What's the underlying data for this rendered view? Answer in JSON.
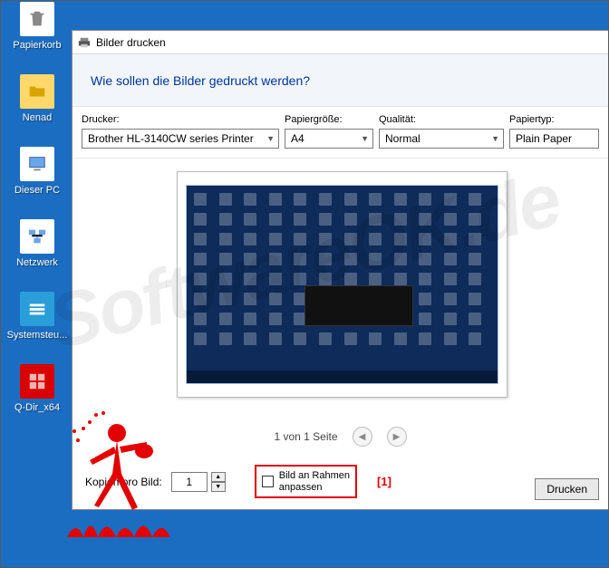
{
  "desktop": {
    "icons": [
      {
        "label": "Papierkorb"
      },
      {
        "label": "Nenad"
      },
      {
        "label": "Dieser PC"
      },
      {
        "label": "Netzwerk"
      },
      {
        "label": "Systemsteu..."
      },
      {
        "label": "Q-Dir_x64"
      }
    ]
  },
  "dialog": {
    "title": "Bilder drucken",
    "banner": "Wie sollen die Bilder gedruckt werden?",
    "options": {
      "printer_label": "Drucker:",
      "printer_value": "Brother HL-3140CW series Printer",
      "papersize_label": "Papiergröße:",
      "papersize_value": "A4",
      "quality_label": "Qualität:",
      "quality_value": "Normal",
      "papertype_label": "Papiertyp:",
      "papertype_value": "Plain Paper"
    },
    "nav": {
      "page_text": "1 von 1 Seite"
    },
    "bottom": {
      "copies_label": "Kopien pro Bild:",
      "copies_value": "1",
      "fit_label": "Bild an Rahmen anpassen",
      "print_button": "Drucken"
    }
  },
  "annotation": {
    "marker": "[1]"
  },
  "watermark": "SoftwareOK.de"
}
